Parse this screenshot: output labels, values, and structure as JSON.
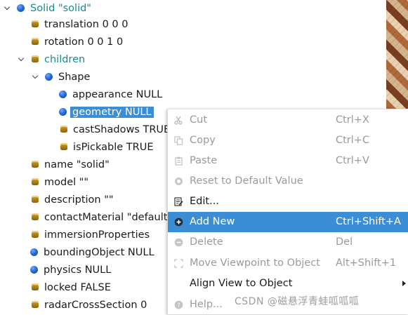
{
  "tree": {
    "nodes": [
      {
        "label": "Solid \"solid\"",
        "icon": "ball-icon",
        "color": "teal"
      },
      {
        "label": "translation 0 0 0",
        "icon": "field-icon"
      },
      {
        "label": "rotation 0 0 1 0",
        "icon": "field-icon"
      },
      {
        "label": "children",
        "icon": "field-icon",
        "color": "teal"
      },
      {
        "label": "Shape",
        "icon": "ball-icon"
      },
      {
        "label": "appearance NULL",
        "icon": "ball-icon"
      },
      {
        "label": "geometry NULL",
        "icon": "ball-icon",
        "selected": true
      },
      {
        "label": "castShadows TRUE",
        "icon": "field-icon"
      },
      {
        "label": "isPickable TRUE",
        "icon": "field-icon"
      },
      {
        "label": "name \"solid\"",
        "icon": "field-icon"
      },
      {
        "label": "model \"\"",
        "icon": "field-icon"
      },
      {
        "label": "description \"\"",
        "icon": "field-icon"
      },
      {
        "label": "contactMaterial \"default\"",
        "icon": "field-icon"
      },
      {
        "label": "immersionProperties",
        "icon": "field-icon"
      },
      {
        "label": "boundingObject NULL",
        "icon": "ball-icon"
      },
      {
        "label": "physics NULL",
        "icon": "ball-icon"
      },
      {
        "label": "locked FALSE",
        "icon": "field-icon"
      },
      {
        "label": "radarCrossSection 0",
        "icon": "field-icon"
      }
    ]
  },
  "context_menu": {
    "items": [
      {
        "label": "Cut",
        "shortcut": "Ctrl+X",
        "enabled": false,
        "icon": "scissors-icon"
      },
      {
        "label": "Copy",
        "shortcut": "Ctrl+C",
        "enabled": false,
        "icon": "copy-icon"
      },
      {
        "label": "Paste",
        "shortcut": "Ctrl+V",
        "enabled": false,
        "icon": "paste-icon"
      },
      {
        "label": "Reset to Default Value",
        "shortcut": "",
        "enabled": false,
        "icon": "reset-icon"
      },
      {
        "label": "Edit...",
        "shortcut": "",
        "enabled": true,
        "icon": "edit-icon"
      },
      {
        "label": "Add New",
        "shortcut": "Ctrl+Shift+A",
        "enabled": true,
        "highlighted": true,
        "icon": "add-icon"
      },
      {
        "label": "Delete",
        "shortcut": "Del",
        "enabled": false,
        "icon": "delete-icon"
      },
      {
        "label": "Move Viewpoint to Object",
        "shortcut": "Alt+Shift+1",
        "enabled": false,
        "icon": "move-viewpoint-icon"
      },
      {
        "label": "Align View to Object",
        "shortcut": "",
        "enabled": true,
        "submenu": true,
        "icon": ""
      },
      {
        "label": "Help...",
        "shortcut": "",
        "enabled": false,
        "icon": "help-icon"
      }
    ]
  },
  "watermark": "CSDN @磁悬浮青蛙呱呱呱",
  "colors": {
    "selection": "#3b8ed6",
    "teal_text": "#1c8a8a",
    "disabled_text": "#9a9a9a"
  }
}
